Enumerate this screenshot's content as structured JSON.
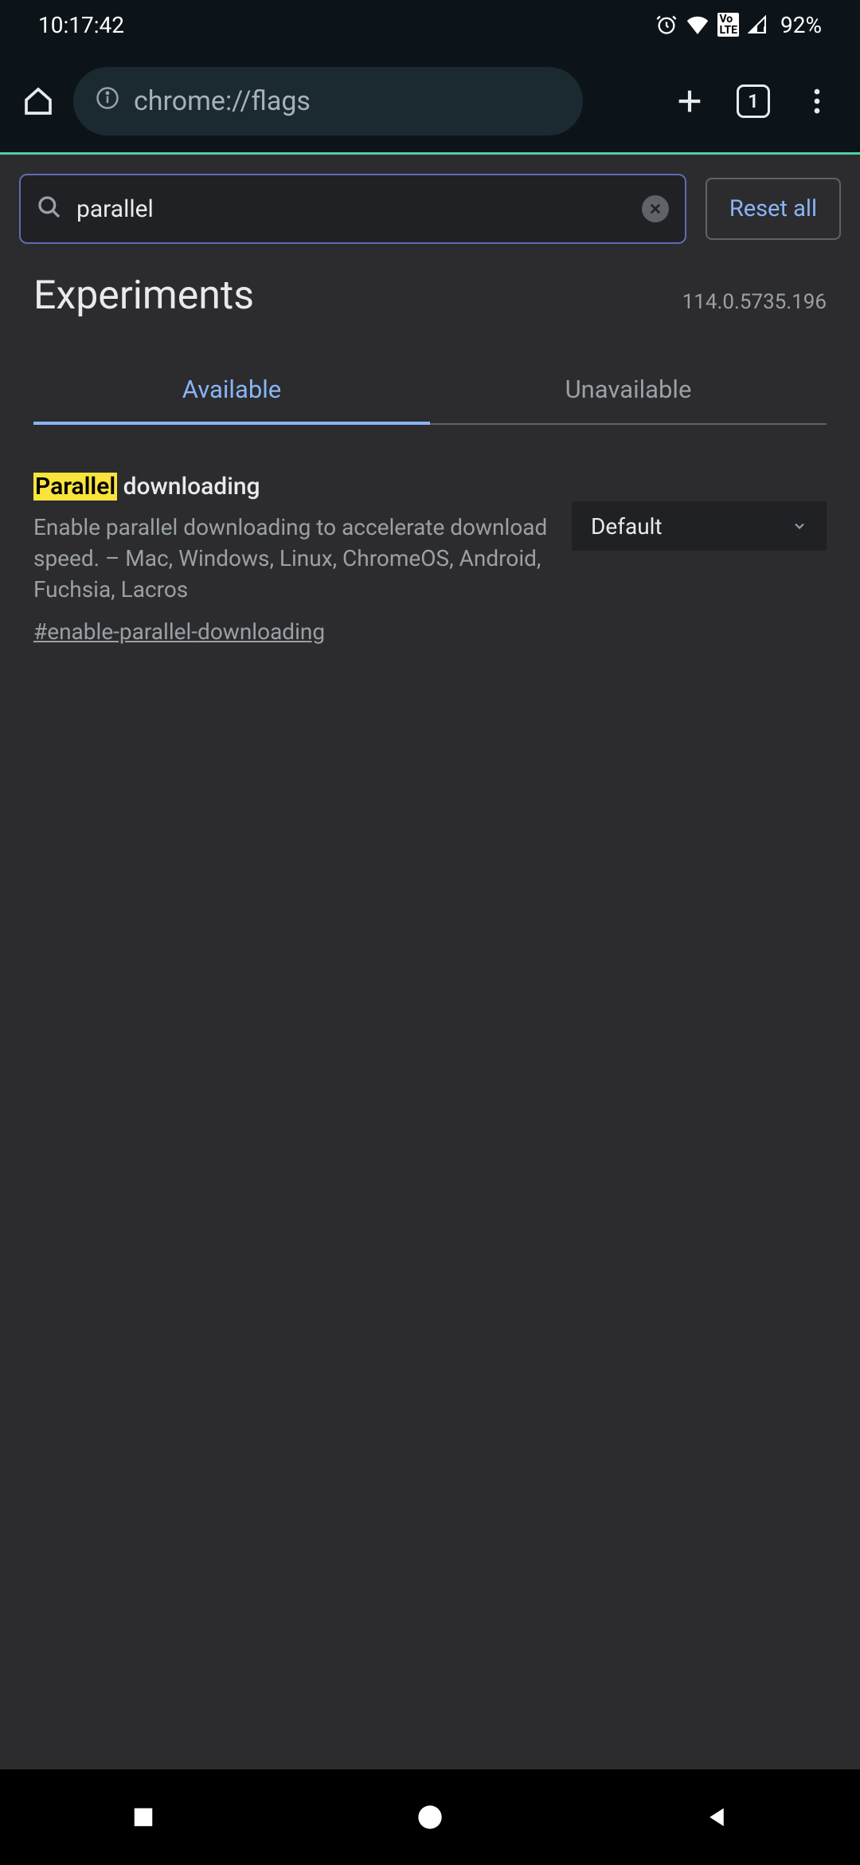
{
  "status_bar": {
    "time": "10:17:42",
    "battery": "92%"
  },
  "browser": {
    "url": "chrome://flags",
    "tab_count": "1"
  },
  "page": {
    "search_value": "parallel",
    "reset_label": "Reset all",
    "title": "Experiments",
    "version": "114.0.5735.196",
    "tabs": {
      "available": "Available",
      "unavailable": "Unavailable"
    },
    "flag": {
      "title_highlight": "Parallel",
      "title_rest": " downloading",
      "description": "Enable parallel downloading to accelerate download speed. – Mac, Windows, Linux, ChromeOS, Android, Fuchsia, Lacros",
      "anchor": "#enable-parallel-downloading",
      "select_value": "Default"
    }
  }
}
